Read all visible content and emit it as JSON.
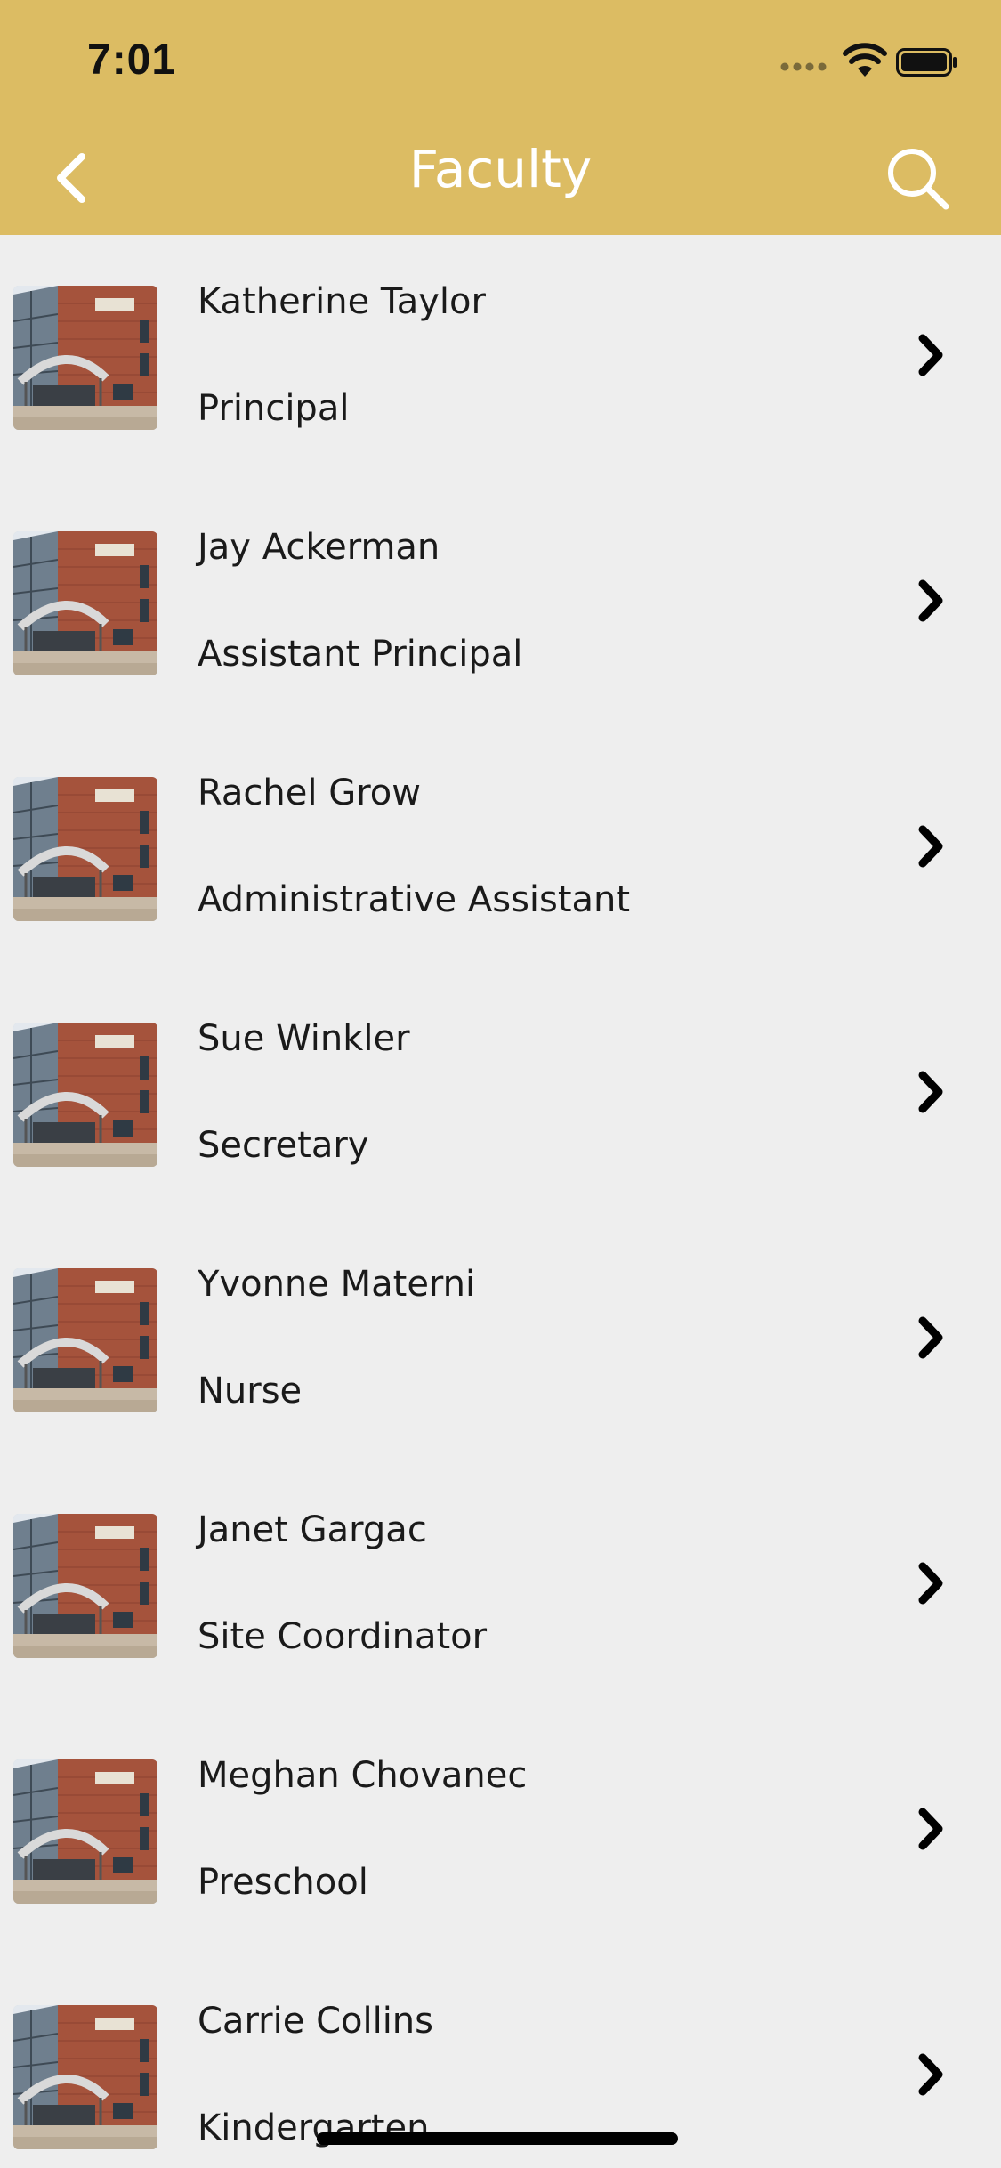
{
  "status_bar": {
    "time": "7:01"
  },
  "nav": {
    "title": "Faculty",
    "back_icon": "chevron-left-icon",
    "search_icon": "search-icon"
  },
  "colors": {
    "header": "#dcbc63",
    "background": "#eeeeee"
  },
  "faculty": [
    {
      "name": "Katherine Taylor",
      "role": "Principal"
    },
    {
      "name": "Jay Ackerman",
      "role": "Assistant Principal"
    },
    {
      "name": "Rachel Grow",
      "role": "Administrative Assistant"
    },
    {
      "name": "Sue Winkler",
      "role": "Secretary"
    },
    {
      "name": "Yvonne Materni",
      "role": "Nurse"
    },
    {
      "name": "Janet Gargac",
      "role": "Site Coordinator"
    },
    {
      "name": "Meghan Chovanec",
      "role": "Preschool"
    },
    {
      "name": "Carrie Collins",
      "role": "Kindergarten"
    }
  ]
}
